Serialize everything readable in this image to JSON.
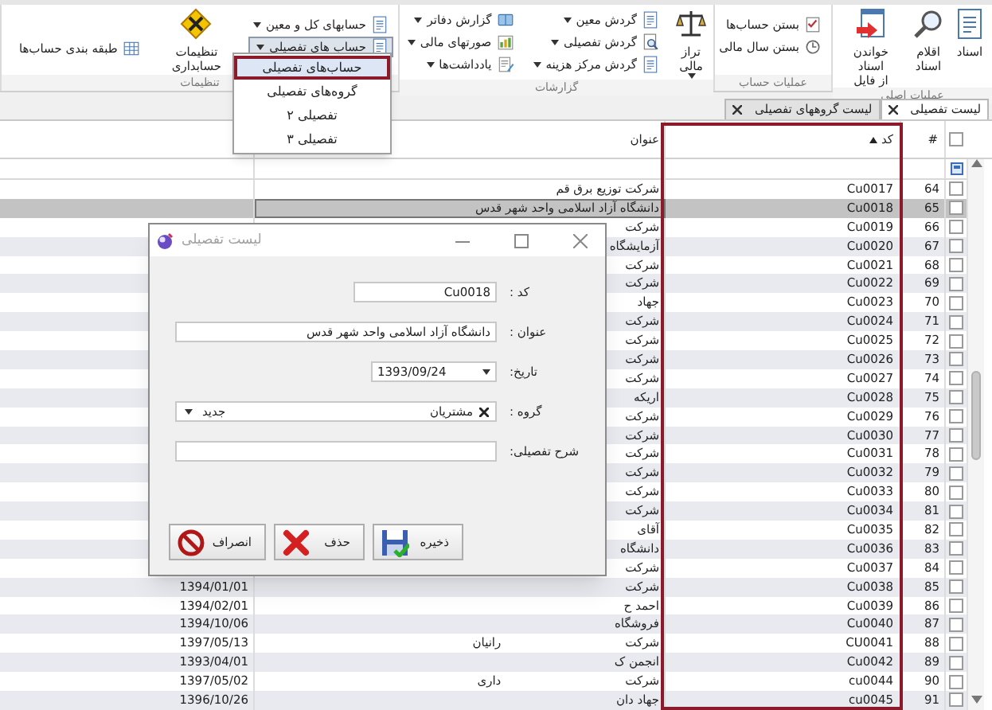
{
  "ribbon": {
    "groups": [
      {
        "label": "عملیات اصلی",
        "items": [
          {
            "kind": "large",
            "label": "اسناد",
            "dropdown": false
          },
          {
            "kind": "large",
            "label": "اقلام\nاسناد",
            "dropdown": false
          },
          {
            "kind": "large",
            "label": "خواندن اسناد\nاز فایل",
            "dropdown": false
          }
        ]
      },
      {
        "label": "عملیات حساب",
        "items": [
          {
            "kind": "column",
            "buttons": [
              {
                "label": "بستن حساب‌ها",
                "dropdown": false
              },
              {
                "label": "بستن سال مالی",
                "dropdown": false
              }
            ]
          }
        ]
      },
      {
        "label": "گزارشات",
        "items": [
          {
            "kind": "large",
            "label": "تراز مالی",
            "dropdown": true
          },
          {
            "kind": "column",
            "buttons": [
              {
                "label": "گردش معین",
                "dropdown": true
              },
              {
                "label": "گردش تفصیلی",
                "dropdown": true
              },
              {
                "label": "گردش مرکز هزینه",
                "dropdown": true
              }
            ]
          },
          {
            "kind": "column",
            "buttons": [
              {
                "label": "گزارش دفاتر",
                "dropdown": true
              },
              {
                "label": "صورتهای مالی",
                "dropdown": true
              },
              {
                "label": "یادداشت‌ها",
                "dropdown": true
              }
            ]
          }
        ]
      },
      {
        "label": "تنظیمات",
        "items": [
          {
            "kind": "column",
            "buttons": [
              {
                "label": "حسابهای کل و معین",
                "dropdown": true,
                "pressed": false
              },
              {
                "label": "حساب های تفصیلی",
                "dropdown": true,
                "pressed": true
              }
            ]
          },
          {
            "kind": "large",
            "label": "تنظیمات\nحسابداری",
            "dropdown": false
          },
          {
            "kind": "column",
            "buttons": [
              {
                "label": "طبقه بندی حساب‌ها",
                "dropdown": false
              }
            ]
          }
        ]
      }
    ]
  },
  "menu": {
    "items": [
      {
        "label": "حساب‌های تفصیلی",
        "selected": true
      },
      {
        "label": "گروه‌های تفصیلی",
        "selected": false
      },
      {
        "label": "تفصیلی ۲",
        "selected": false
      },
      {
        "label": "تفصیلی ۳",
        "selected": false
      }
    ]
  },
  "tabs": [
    {
      "label": "لیست تفصیلی",
      "selected": true
    },
    {
      "label": "لیست گروههای تفصیلی",
      "selected": false
    }
  ],
  "table": {
    "all_checked": false,
    "columns": [
      {
        "label": "#"
      },
      {
        "label": "کد",
        "sorted_ascending": true
      },
      {
        "label": "عنوان"
      }
    ],
    "rows": [
      {
        "number": "64",
        "code": "Cu0017",
        "title": "شرکت توزیع برق قم",
        "checked": false,
        "selected": false
      },
      {
        "number": "65",
        "code": "Cu0018",
        "title": "دانشگاه آزاد اسلامی واحد شهر قدس",
        "checked": false,
        "selected": true
      },
      {
        "number": "66",
        "code": "Cu0019",
        "title": "شرکت",
        "checked": false,
        "selected": false
      },
      {
        "number": "67",
        "code": "Cu0020",
        "title": "آزمایشگاه",
        "checked": false,
        "selected": false
      },
      {
        "number": "68",
        "code": "Cu0021",
        "title": "شرکت",
        "checked": false,
        "selected": false
      },
      {
        "number": "69",
        "code": "Cu0022",
        "title": "شرکت",
        "checked": false,
        "selected": false
      },
      {
        "number": "70",
        "code": "Cu0023",
        "title": "جهاد",
        "checked": false,
        "selected": false
      },
      {
        "number": "71",
        "code": "Cu0024",
        "title": "شرکت",
        "checked": false,
        "selected": false
      },
      {
        "number": "72",
        "code": "Cu0025",
        "title": "شرکت",
        "checked": false,
        "selected": false
      },
      {
        "number": "73",
        "code": "Cu0026",
        "title": "شرکت",
        "checked": false,
        "selected": false
      },
      {
        "number": "74",
        "code": "Cu0027",
        "title": "شرکت",
        "checked": false,
        "selected": false
      },
      {
        "number": "75",
        "code": "Cu0028",
        "title": "اریکه",
        "checked": false,
        "selected": false
      },
      {
        "number": "76",
        "code": "Cu0029",
        "title": "شرکت",
        "checked": false,
        "selected": false
      },
      {
        "number": "77",
        "code": "Cu0030",
        "title": "شرکت",
        "checked": false,
        "selected": false
      },
      {
        "number": "78",
        "code": "Cu0031",
        "title": "شرکت",
        "checked": false,
        "selected": false
      },
      {
        "number": "79",
        "code": "Cu0032",
        "title": "شرکت",
        "checked": false,
        "selected": false
      },
      {
        "number": "80",
        "code": "Cu0033",
        "title": "شرکت",
        "checked": false,
        "selected": false
      },
      {
        "number": "81",
        "code": "Cu0034",
        "title": "شرکت",
        "checked": false,
        "selected": false
      },
      {
        "number": "82",
        "code": "Cu0035",
        "title": "آقای",
        "checked": false,
        "selected": false
      },
      {
        "number": "83",
        "code": "Cu0036",
        "title": "دانشگاه",
        "checked": false,
        "selected": false
      },
      {
        "number": "84",
        "code": "Cu0037",
        "title": "شرکت",
        "checked": false,
        "selected": false
      },
      {
        "number": "85",
        "code": "Cu0038",
        "title": "شرکت",
        "date": "1394/01/01",
        "checked": false,
        "selected": false
      },
      {
        "number": "86",
        "code": "Cu0039",
        "title": "احمد ح",
        "date": "1394/02/01",
        "checked": false,
        "selected": false
      },
      {
        "number": "87",
        "code": "Cu0040",
        "title": "فروشگاه",
        "date": "1394/10/06",
        "checked": false,
        "selected": false
      },
      {
        "number": "88",
        "code": "CU0041",
        "title": "شرکت",
        "title_end": "رانیان",
        "date": "1397/05/13",
        "checked": false,
        "selected": false
      },
      {
        "number": "89",
        "code": "Cu0042",
        "title": "انجمن ک",
        "date": "1393/04/01",
        "checked": false,
        "selected": false
      },
      {
        "number": "90",
        "code": "cu0044",
        "title": "شرکت",
        "title_end": "داری",
        "date": "1397/05/02",
        "checked": false,
        "selected": false
      },
      {
        "number": "91",
        "code": "cu0045",
        "title": "جهاد دان",
        "date": "1396/10/26",
        "checked": false,
        "selected": false
      }
    ]
  },
  "dialog": {
    "title": "لیست تفصیلی",
    "fields": [
      {
        "kind": "short",
        "label": "کد :",
        "value": "Cu0018"
      },
      {
        "kind": "wide",
        "label": "عنوان :",
        "value": "دانشگاه آزاد اسلامی واحد شهر قدس"
      },
      {
        "kind": "date",
        "label": "تاریخ:",
        "value": "1393/09/24"
      },
      {
        "kind": "tags",
        "label": "گروه :",
        "tag": "مشتریان",
        "action": "جدید"
      },
      {
        "kind": "wide",
        "label": "شرح تفصیلی:"
      }
    ],
    "buttons": [
      {
        "label": "ذخیره"
      },
      {
        "label": "حذف"
      },
      {
        "label": "انصراف"
      }
    ]
  }
}
